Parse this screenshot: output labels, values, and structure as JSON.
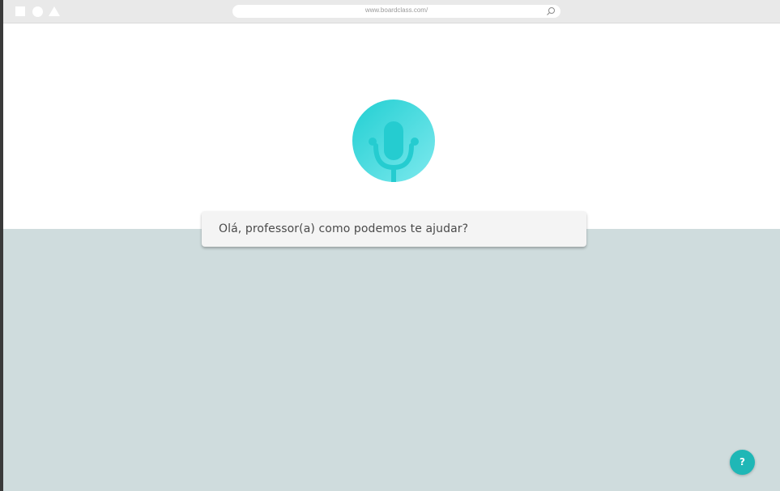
{
  "browser": {
    "url": "www.boardclass.com/",
    "icons": [
      "square-icon",
      "circle-icon",
      "triangle-icon",
      "search-icon"
    ]
  },
  "assistant": {
    "avatar_icon": "microphone-face-icon",
    "prompt": "Olá, professor(a) como podemos te ajudar?"
  },
  "help": {
    "label": "?"
  },
  "colors": {
    "accent": "#2bcdd0",
    "panel": "#cfdcdd",
    "help_button": "#1fb7b6"
  }
}
